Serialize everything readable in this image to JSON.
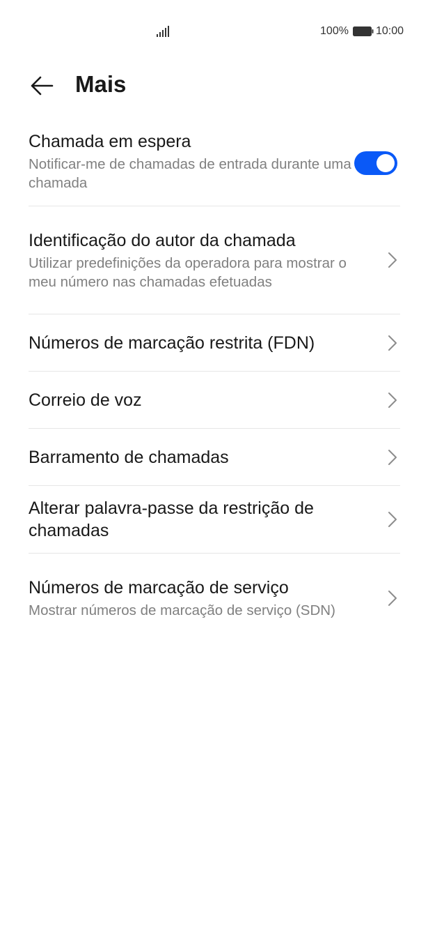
{
  "status_bar": {
    "signal_icon": "signal-bars-icon",
    "battery_percent": "100%",
    "battery_icon": "battery-full-icon",
    "time": "10:00"
  },
  "header": {
    "back_icon": "arrow-left-icon",
    "title": "Mais"
  },
  "colors": {
    "accent": "#0a59f7",
    "text_primary": "#191919",
    "text_secondary": "#808080",
    "divider": "#e6e6e6"
  },
  "settings": [
    {
      "title": "Chamada em espera",
      "subtitle": "Notificar-me de chamadas de entrada durante uma chamada",
      "control": "toggle",
      "toggle_on": true
    },
    {
      "title": "Identificação do autor da chamada",
      "subtitle": "Utilizar predefinições da operadora para mostrar o meu número nas chamadas efetuadas",
      "control": "chevron-right-icon"
    },
    {
      "title": "Números de marcação restrita (FDN)",
      "control": "chevron-right-icon"
    },
    {
      "title": "Correio de voz",
      "control": "chevron-right-icon"
    },
    {
      "title": "Barramento de chamadas",
      "control": "chevron-right-icon"
    },
    {
      "title": "Alterar palavra-passe da restrição de chamadas",
      "control": "chevron-right-icon"
    },
    {
      "title": "Números de marcação de serviço",
      "subtitle": "Mostrar números de marcação de serviço (SDN)",
      "control": "chevron-right-icon"
    }
  ]
}
